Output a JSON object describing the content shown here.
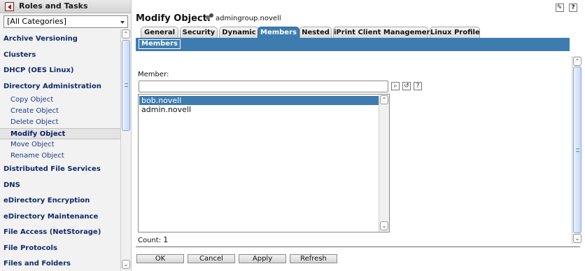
{
  "left": {
    "header_title": "Roles and Tasks",
    "category_select": "[All Categories]",
    "items": [
      {
        "kind": "category",
        "label": "Archive Versioning"
      },
      {
        "kind": "category",
        "label": "Clusters"
      },
      {
        "kind": "category",
        "label": "DHCP (OES Linux)"
      },
      {
        "kind": "category",
        "label": "Directory Administration"
      },
      {
        "kind": "task",
        "label": "Copy Object"
      },
      {
        "kind": "task",
        "label": "Create Object"
      },
      {
        "kind": "task",
        "label": "Delete Object"
      },
      {
        "kind": "task",
        "label": "Modify Object",
        "active": true
      },
      {
        "kind": "task",
        "label": "Move Object"
      },
      {
        "kind": "task",
        "label": "Rename Object"
      },
      {
        "kind": "category",
        "label": "Distributed File Services"
      },
      {
        "kind": "category",
        "label": "DNS"
      },
      {
        "kind": "category",
        "label": "eDirectory Encryption"
      },
      {
        "kind": "category",
        "label": "eDirectory Maintenance"
      },
      {
        "kind": "category",
        "label": "File Access (NetStorage)"
      },
      {
        "kind": "category",
        "label": "File Protocols"
      },
      {
        "kind": "category",
        "label": "Files and Folders"
      }
    ]
  },
  "main": {
    "title": "Modify Object:",
    "object_name": "admingroup.novell",
    "tabs": [
      "General",
      "Security",
      "Dynamic",
      "Members",
      "Nested",
      "iPrint Client Management",
      "Linux Profile"
    ],
    "active_tab": "Members",
    "section_label": "Members",
    "member_label": "Member:",
    "member_input_value": "",
    "members": [
      {
        "name": "bob.novell",
        "selected": true
      },
      {
        "name": "admin.novell",
        "selected": false
      }
    ],
    "count_label": "Count:",
    "count_value": "1",
    "buttons": {
      "ok": "OK",
      "cancel": "Cancel",
      "apply": "Apply",
      "refresh": "Refresh"
    }
  },
  "icons": {
    "top_left": "roles-tasks-icon",
    "top_right_1": "edit-icon",
    "top_right_2": "help-icon",
    "object": "group-icon",
    "browse": "object-selector-icon",
    "history": "history-icon",
    "help": "help-icon"
  },
  "colors": {
    "accent": "#3e7cb0",
    "link": "#1a3a8a",
    "category": "#102a6a"
  }
}
